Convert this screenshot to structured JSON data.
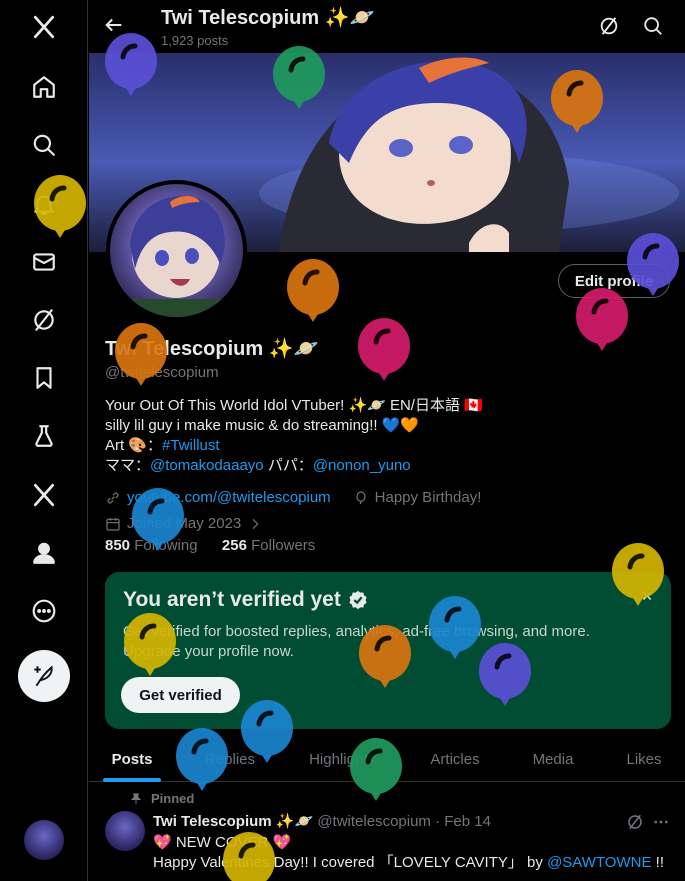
{
  "nav": {
    "items": [
      {
        "name": "x-logo-icon"
      },
      {
        "name": "home-icon"
      },
      {
        "name": "explore-search-icon"
      },
      {
        "name": "notifications-bell-icon"
      },
      {
        "name": "messages-mail-icon"
      },
      {
        "name": "grok-icon"
      },
      {
        "name": "bookmarks-icon"
      },
      {
        "name": "labs-flask-icon"
      },
      {
        "name": "premium-x-icon"
      },
      {
        "name": "profile-person-icon"
      },
      {
        "name": "more-circle-icon"
      }
    ]
  },
  "header": {
    "title": "Twi Telescopium ✨🪐",
    "post_count": "1,923 posts"
  },
  "profile": {
    "edit_label": "Edit profile",
    "name": "Twi Telescopium ✨🪐",
    "handle": "@twitelescopium",
    "bio_line1": "Your Out Of This World Idol VTuber! ✨🪐 EN/日本語 🇨🇦",
    "bio_line2": "silly lil guy i make music & do streaming!! 💙🧡",
    "bio_art_prefix": "Art 🎨：",
    "bio_art_tag": "#Twillust",
    "bio_mama_prefix": "ママ：",
    "bio_mama_link": "@tomakodaaayo",
    "bio_papa_prefix": " パパ：",
    "bio_papa_link": "@nonon_yuno",
    "website": "youtube.com/@twitelescopium",
    "birthday": "Happy Birthday!",
    "joined": "Joined May 2023",
    "following_count": "850",
    "following_label": "Following",
    "followers_count": "256",
    "followers_label": "Followers"
  },
  "verify": {
    "title": "You aren’t verified yet",
    "body": "Get verified for boosted replies, analytics, ad-free browsing, and more. Upgrade your profile now.",
    "button": "Get verified",
    "close": "✕"
  },
  "tabs": [
    "Posts",
    "Replies",
    "Highlights",
    "Articles",
    "Media",
    "Likes"
  ],
  "tweet": {
    "pinned_label": "Pinned",
    "name": "Twi Telescopium ✨🪐",
    "handle_date": "@twitelescopium · Feb 14",
    "line1": "💖 NEW COVER 💖",
    "line2_prefix": "Happy Valentines Day!! I covered 「LOVELY CAVITY」 by ",
    "line2_link": "@SAWTOWNE",
    "line2_suffix": " !!"
  },
  "colors": {
    "accent": "#1d9bf0",
    "verify_bg": "#004d33",
    "balloon_purple": "#5a4fd6",
    "balloon_green": "#1f9a5c",
    "balloon_orange": "#d9740f",
    "balloon_yellow": "#d4b400",
    "balloon_magenta": "#d41a6a",
    "balloon_blue": "#1a86d0"
  }
}
